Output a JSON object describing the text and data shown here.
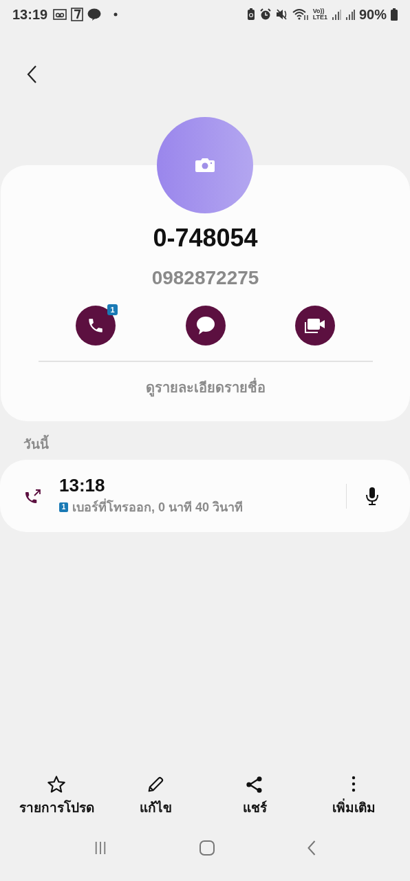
{
  "status_bar": {
    "time": "13:19",
    "volte": "Vo))",
    "network": "LTE1",
    "battery": "90%"
  },
  "contact": {
    "name": "0-748054",
    "number": "0982872275"
  },
  "actions": [
    {
      "kind": "call",
      "badge": "1"
    },
    {
      "kind": "message"
    },
    {
      "kind": "video"
    }
  ],
  "details_link": "ดูรายละเอียดรายชื่อ",
  "section_label": "วันนี้",
  "call_log": [
    {
      "kind": "outgoing",
      "time": "13:18",
      "sim": "1",
      "description": "เบอร์ที่โทรออก, 0 นาที 40 วินาที"
    }
  ],
  "bottom_actions": [
    {
      "kind": "favourite",
      "label": "รายการโปรด"
    },
    {
      "kind": "edit",
      "label": "แก้ไข"
    },
    {
      "kind": "share",
      "label": "แชร์"
    },
    {
      "kind": "more",
      "label": "เพิ่มเติม"
    }
  ]
}
